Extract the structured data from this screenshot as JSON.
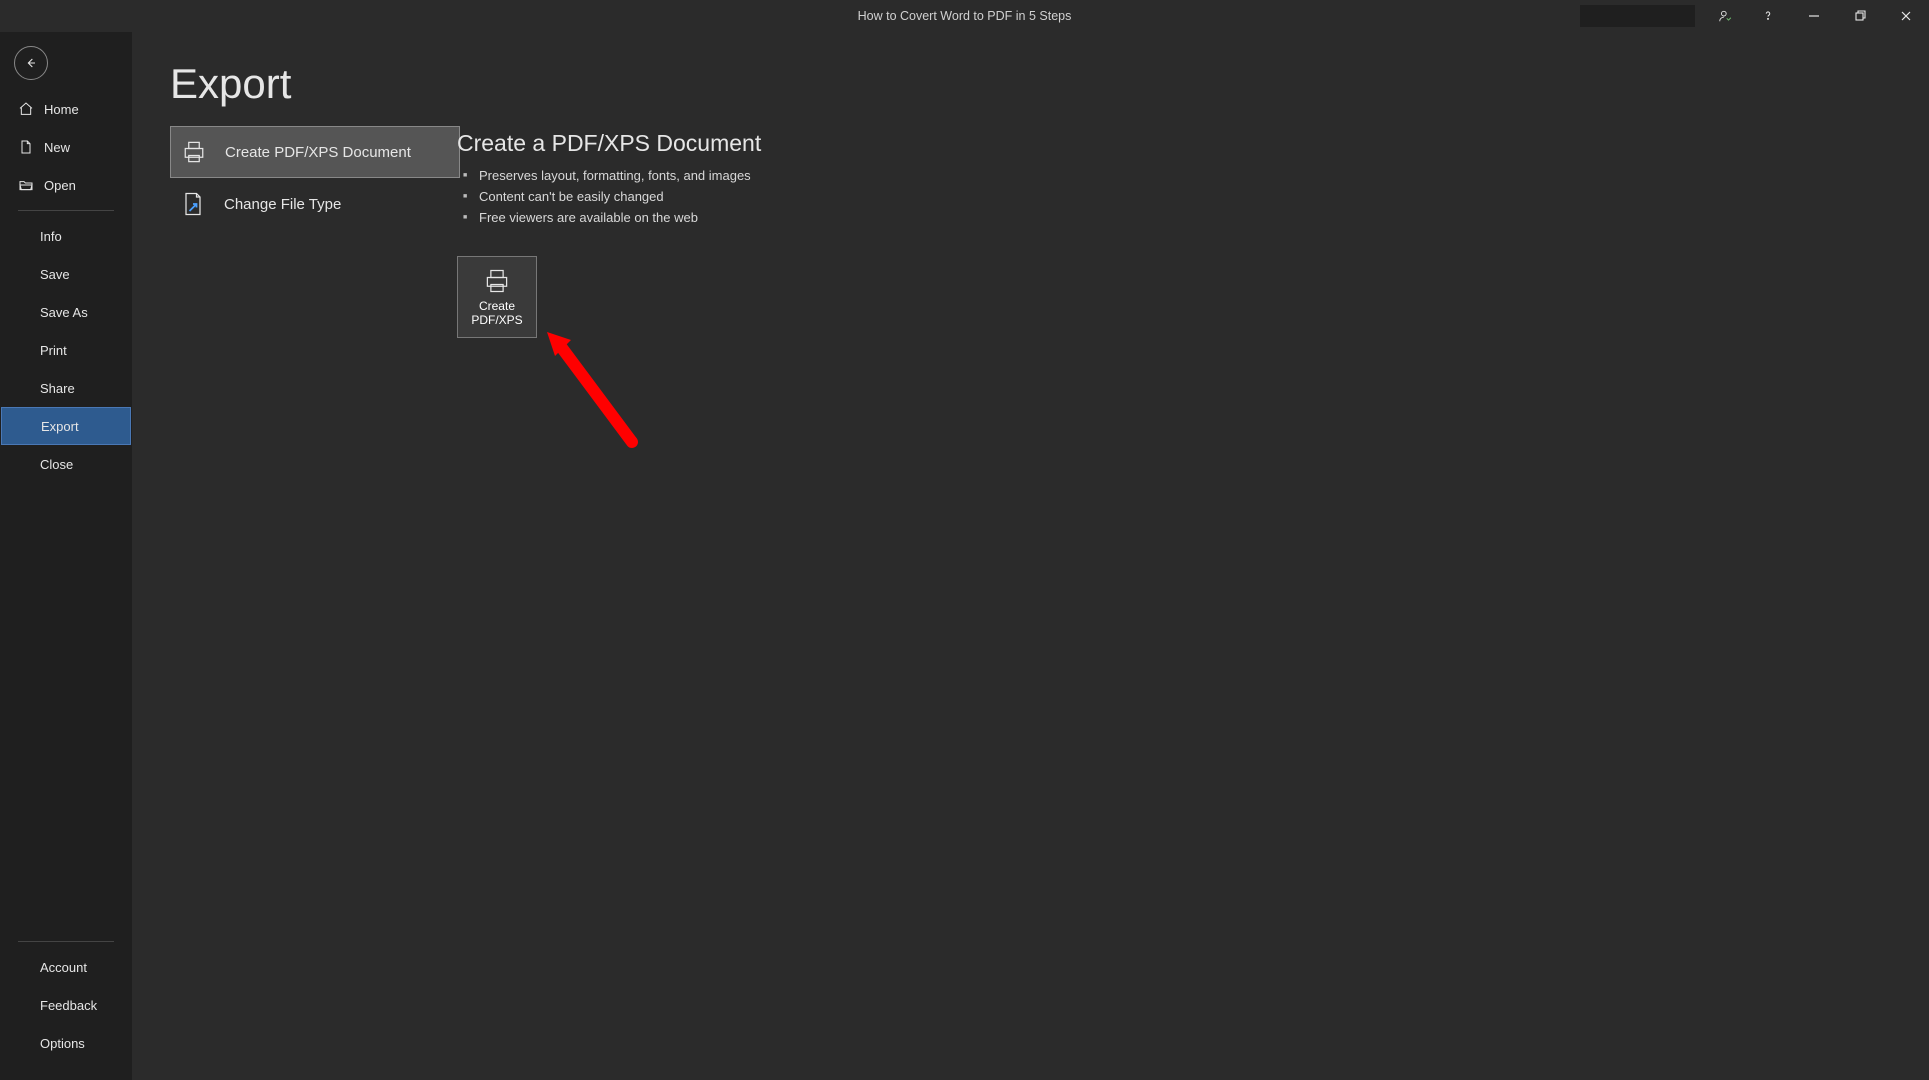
{
  "title": "How to Covert Word to PDF in 5 Steps",
  "sidebar": {
    "top": [
      {
        "label": "Home",
        "icon": "home"
      },
      {
        "label": "New",
        "icon": "new-doc"
      },
      {
        "label": "Open",
        "icon": "open-folder"
      }
    ],
    "middle": [
      {
        "label": "Info"
      },
      {
        "label": "Save"
      },
      {
        "label": "Save As"
      },
      {
        "label": "Print"
      },
      {
        "label": "Share"
      },
      {
        "label": "Export",
        "selected": true
      },
      {
        "label": "Close"
      }
    ],
    "bottom": [
      {
        "label": "Account"
      },
      {
        "label": "Feedback"
      },
      {
        "label": "Options"
      }
    ]
  },
  "page_heading": "Export",
  "export_options": [
    {
      "label": "Create PDF/XPS Document",
      "icon": "pdf-printer",
      "selected": true
    },
    {
      "label": "Change File Type",
      "icon": "change-filetype"
    }
  ],
  "detail": {
    "heading": "Create a PDF/XPS Document",
    "bullets": [
      "Preserves layout, formatting, fonts, and images",
      "Content can't be easily changed",
      "Free viewers are available on the web"
    ],
    "button_line1": "Create",
    "button_line2": "PDF/XPS"
  }
}
